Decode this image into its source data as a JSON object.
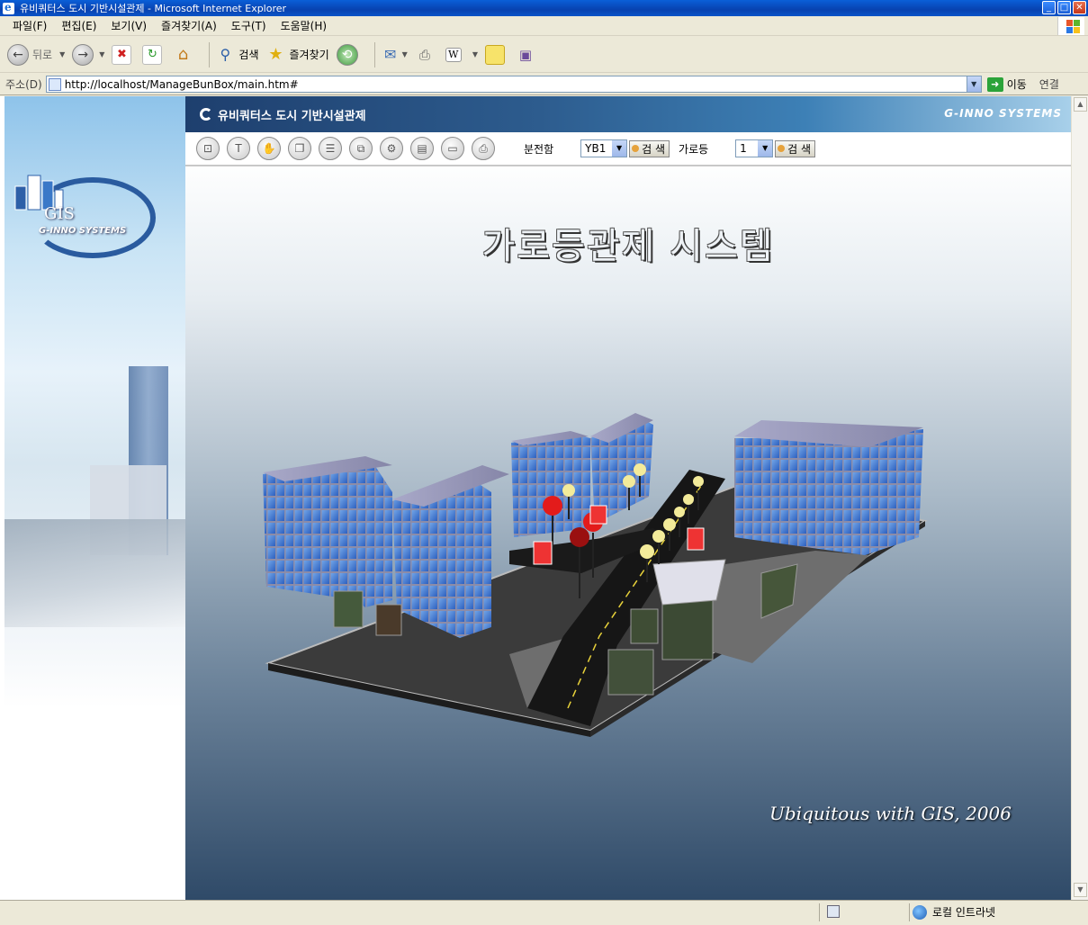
{
  "window": {
    "title": "유비쿼터스 도시 기반시설관제 - Microsoft Internet Explorer",
    "buttons": {
      "minimize": "_",
      "maximize": "□",
      "close": "✕"
    }
  },
  "menu": [
    "파일(F)",
    "편집(E)",
    "보기(V)",
    "즐겨찾기(A)",
    "도구(T)",
    "도움말(H)"
  ],
  "ie_toolbar": {
    "back": "뒤로",
    "search": "검색",
    "favorites": "즐겨찾기"
  },
  "address": {
    "label": "주소(D)",
    "url": "http://localhost/ManageBunBox/main.htm#",
    "go": "이동",
    "links": "연결"
  },
  "banner": {
    "gis": "GIS",
    "brand": "G-INNO SYSTEMS"
  },
  "app": {
    "title": "유비쿼터스 도시 기반시설관제",
    "brand": "G-INNO SYSTEMS",
    "filter1_label": "분전함",
    "filter1_value": "YB1",
    "filter2_label": "가로등",
    "filter2_value": "1",
    "search_label": "검 색"
  },
  "viewport": {
    "heading": "가로등관제 시스템",
    "caption": "Ubiquitous with GIS, 2006"
  },
  "status": {
    "zone": "로컬 인트라넷"
  },
  "colors": {
    "title_blue": "#0a54c8",
    "app_header": "#2d5c8e",
    "lamp_red": "#e31b1b",
    "lamp_yellow": "#f3eb9a"
  }
}
